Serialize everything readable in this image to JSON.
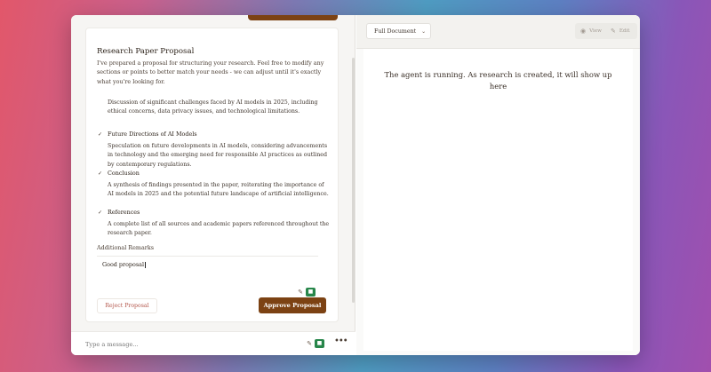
{
  "proposal": {
    "title": "Research Paper Proposal",
    "intro": "I've prepared a proposal for structuring your research. Feel free to modify any sections or points to better match your needs - we can adjust until it's exactly what you're looking for.",
    "sections": [
      {
        "heading": "",
        "description": "Discussion of significant challenges faced by AI models in 2025, including ethical concerns, data privacy issues, and technological limitations."
      },
      {
        "heading": "Future Directions of AI Models",
        "description": "Speculation on future developments in AI models, considering advancements in technology and the emerging need for responsible AI practices as outlined by contemporary regulations."
      },
      {
        "heading": "Conclusion",
        "description": "A synthesis of findings presented in the paper, reiterating the importance of AI models in 2025 and the potential future landscape of artificial intelligence."
      },
      {
        "heading": "References",
        "description": "A complete list of all sources and academic papers referenced throughout the research paper."
      }
    ],
    "remarks_label": "Additional Remarks",
    "remarks_value": "Good proposal",
    "reject_label": "Reject Proposal",
    "approve_label": "Approve Proposal"
  },
  "chat": {
    "placeholder": "Type a message...",
    "more_label": "•••"
  },
  "document": {
    "view_select": "Full Document",
    "view_label": "View",
    "edit_label": "Edit",
    "status_message": "The agent is running. As research is created, it will show up here"
  },
  "icons": {
    "check": "check-icon",
    "brush": "brush-icon",
    "camera": "camera-icon",
    "eye": "eye-icon",
    "pencil": "pencil-icon",
    "chevron": "chevron-down-icon"
  },
  "colors": {
    "accent": "#7c4213",
    "reject_text": "#b3554a",
    "camera_green": "#27864a"
  }
}
